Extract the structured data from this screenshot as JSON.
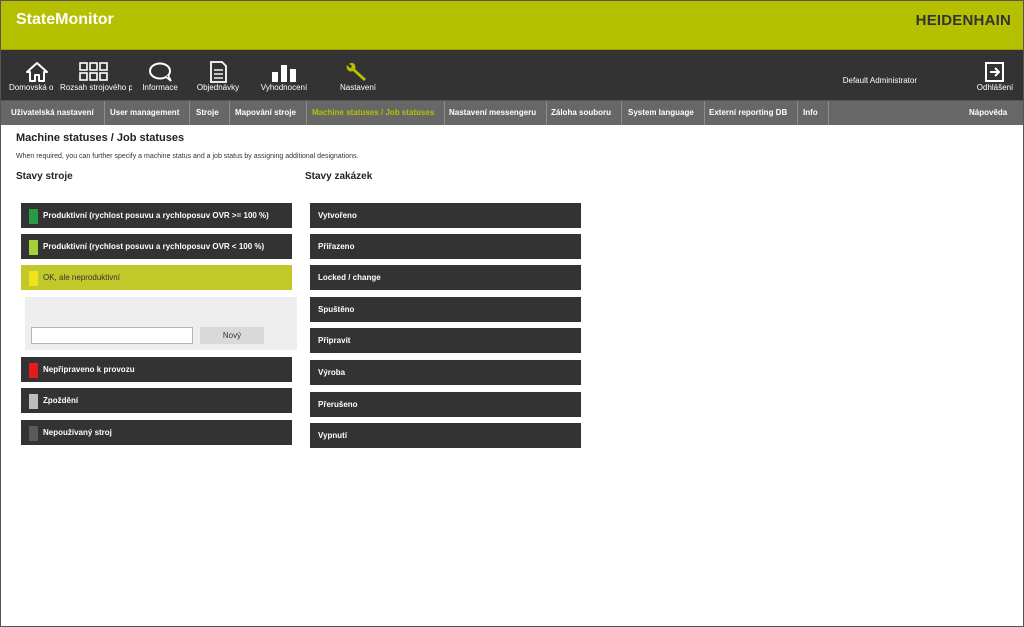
{
  "app": {
    "title": "StateMonitor",
    "brand": "HEIDENHAIN"
  },
  "nav": {
    "items": [
      {
        "label": "Domovská obrazovka",
        "icon": "home-icon"
      },
      {
        "label": "Rozsah strojového parku",
        "icon": "grid-icon"
      },
      {
        "label": "Informace",
        "icon": "chat-bubble-icon"
      },
      {
        "label": "Objednávky",
        "icon": "document-icon"
      },
      {
        "label": "Vyhodnocení",
        "icon": "bar-chart-icon"
      },
      {
        "label": "Nastavení",
        "icon": "wrench-icon"
      }
    ],
    "user": "Default Administrator",
    "logout": "Odhlášení"
  },
  "tabs": [
    "Uživatelská nastavení",
    "User management",
    "Stroje",
    "Mapování stroje",
    "Machine statuses / Job statuses",
    "Nastavení messengeru",
    "Záloha souboru",
    "System language",
    "Externí reporting DB",
    "Info"
  ],
  "help": "Nápověda",
  "page": {
    "title": "Machine statuses / Job statuses",
    "description": "When required, you can further specify a machine status and a job status by assigning additional designations."
  },
  "machine": {
    "heading": "Stavy stroje",
    "states": [
      {
        "label": "Produktivní (rychlost posuvu a rychloposuv OVR >= 100 %)",
        "color": "#2a9a46"
      },
      {
        "label": "Produktivní (rychlost posuvu a rychloposuv OVR < 100 %)",
        "color": "#a6cf3a"
      },
      {
        "label": "OK, ale neproduktivní",
        "color": "#f0e21c"
      },
      {
        "label": "Nepřipraveno k provozu",
        "color": "#e31b1b"
      },
      {
        "label": "Zpoždění",
        "color": "#bdbdbd"
      },
      {
        "label": "Nepoužívaný stroj",
        "color": "#5a5a5a"
      }
    ],
    "new_input_value": "",
    "new_button": "Nový"
  },
  "jobs": {
    "heading": "Stavy zakázek",
    "states": [
      "Vytvořeno",
      "Přiřazeno",
      "Locked / change",
      "Spuštěno",
      "Připravit",
      "Výroba",
      "Přerušeno",
      "Vypnutí"
    ]
  },
  "colors": {
    "accent": "#b5c000",
    "dark": "#333333",
    "tabbar": "#676767",
    "selected": "#c3c82a"
  }
}
